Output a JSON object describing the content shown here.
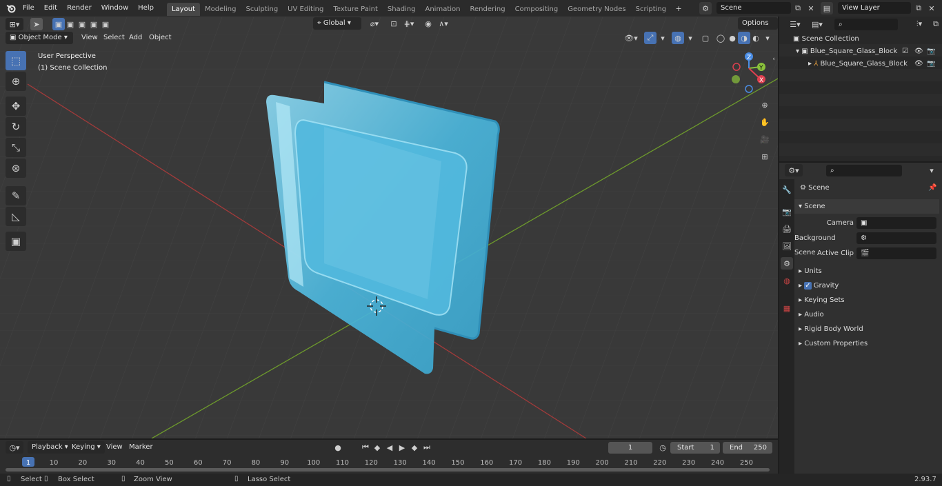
{
  "menu": [
    "File",
    "Edit",
    "Render",
    "Window",
    "Help"
  ],
  "workspaces": [
    "Layout",
    "Modeling",
    "Sculpting",
    "UV Editing",
    "Texture Paint",
    "Shading",
    "Animation",
    "Rendering",
    "Compositing",
    "Geometry Nodes",
    "Scripting"
  ],
  "active_workspace": "Layout",
  "scene_field": "Scene",
  "view_layer_field": "View Layer",
  "viewport": {
    "mode": "Object Mode",
    "menus": [
      "View",
      "Select",
      "Add",
      "Object"
    ],
    "transform_orientation": "Global",
    "options_label": "Options",
    "overlay_title": "User Perspective",
    "overlay_subtitle": "(1) Scene Collection",
    "gizmo": {
      "x": "X",
      "y": "Y",
      "z": "Z"
    }
  },
  "outliner": {
    "root": "Scene Collection",
    "items": [
      "Blue_Square_Glass_Block",
      "Blue_Square_Glass_Block"
    ]
  },
  "properties": {
    "context": "Scene",
    "panel": "Scene",
    "fields": [
      {
        "label": "Camera"
      },
      {
        "label": "Background Scene"
      },
      {
        "label": "Active Clip"
      }
    ],
    "sections": [
      "Units",
      "Gravity",
      "Keying Sets",
      "Audio",
      "Rigid Body World",
      "Custom Properties"
    ]
  },
  "timeline": {
    "menus": [
      "Playback",
      "Keying",
      "View",
      "Marker"
    ],
    "current_frame": "1",
    "start_label": "Start",
    "start_value": "1",
    "end_label": "End",
    "end_value": "250",
    "ticks": [
      "1",
      "10",
      "20",
      "30",
      "40",
      "50",
      "60",
      "70",
      "80",
      "90",
      "100",
      "110",
      "120",
      "130",
      "140",
      "150",
      "160",
      "170",
      "180",
      "190",
      "200",
      "210",
      "220",
      "230",
      "240",
      "250"
    ]
  },
  "status": {
    "select": "Select",
    "box_select": "Box Select",
    "zoom_view": "Zoom View",
    "lasso_select": "Lasso Select",
    "version": "2.93.7"
  },
  "colors": {
    "accent": "#4772b3",
    "x_axis": "#b03636",
    "y_axis": "#6a9a2a",
    "glass": "#5ec6e6"
  }
}
